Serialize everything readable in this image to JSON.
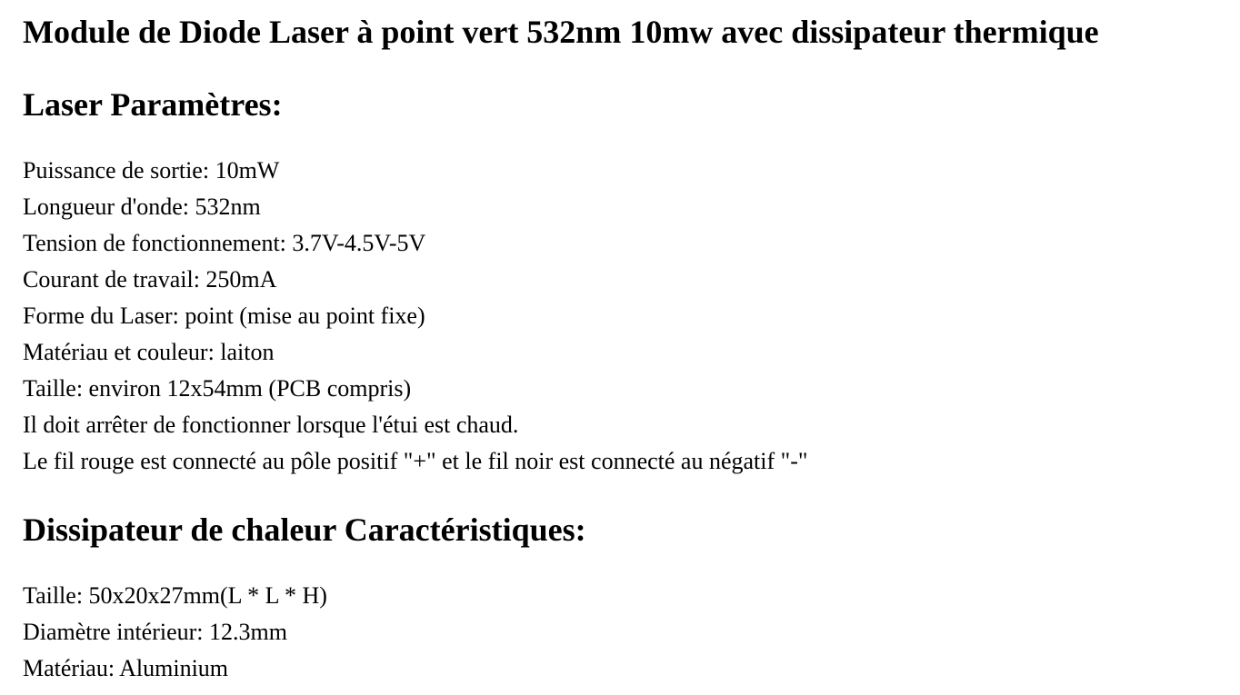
{
  "title": "Module de Diode Laser à point vert 532nm 10mw avec dissipateur thermique",
  "laser_section": {
    "heading": "Laser Paramètres:",
    "items": [
      "Puissance de sortie: 10mW",
      "Longueur d'onde: 532nm",
      "Tension de fonctionnement: 3.7V-4.5V-5V",
      "Courant de travail: 250mA",
      "Forme du Laser: point (mise au point fixe)",
      "Matériau et couleur: laiton",
      "Taille: environ 12x54mm (PCB compris)",
      "Il doit arrêter de fonctionner lorsque l'étui est chaud.",
      "Le fil rouge est connecté au pôle positif \"+\" et le fil noir est connecté au négatif \"-\""
    ]
  },
  "heatsink_section": {
    "heading": "Dissipateur de chaleur Caractéristiques:",
    "items": [
      "Taille: 50x20x27mm(L * L * H)",
      "Diamètre intérieur: 12.3mm",
      "Matériau: Aluminium"
    ]
  }
}
